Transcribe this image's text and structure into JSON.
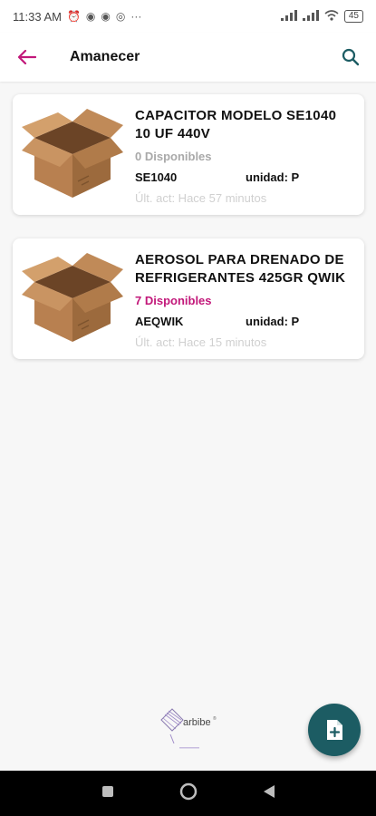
{
  "status_bar": {
    "time": "11:33 AM",
    "notification_icons": [
      "alarm-icon",
      "telegram-icon",
      "telegram-icon",
      "whatsapp-icon"
    ],
    "more": "···",
    "battery": "45"
  },
  "app_bar": {
    "title": "Amanecer",
    "accent_color": "#c2187a"
  },
  "products": [
    {
      "name": "CAPACITOR MODELO SE1040 10 UF 440V",
      "availability": "0 Disponibles",
      "availability_color": "#a9a9a9",
      "code": "SE1040",
      "unit": "unidad: P",
      "updated": "Últ. act: Hace 57 minutos"
    },
    {
      "name": "AEROSOL PARA DRENADO DE REFRIGERANTES 425GR QWIK",
      "availability": "7 Disponibles",
      "availability_color": "#c2187a",
      "code": "AEQWIK",
      "unit": "unidad: P",
      "updated": "Últ. act: Hace 15 minutos"
    }
  ],
  "brand": {
    "name": "arbibe",
    "mark": "®"
  },
  "fab": {
    "icon": "add-file-icon",
    "color": "#1c5c63"
  },
  "nav_bar": {
    "icons": [
      "recents-icon",
      "home-icon",
      "back-icon"
    ]
  }
}
